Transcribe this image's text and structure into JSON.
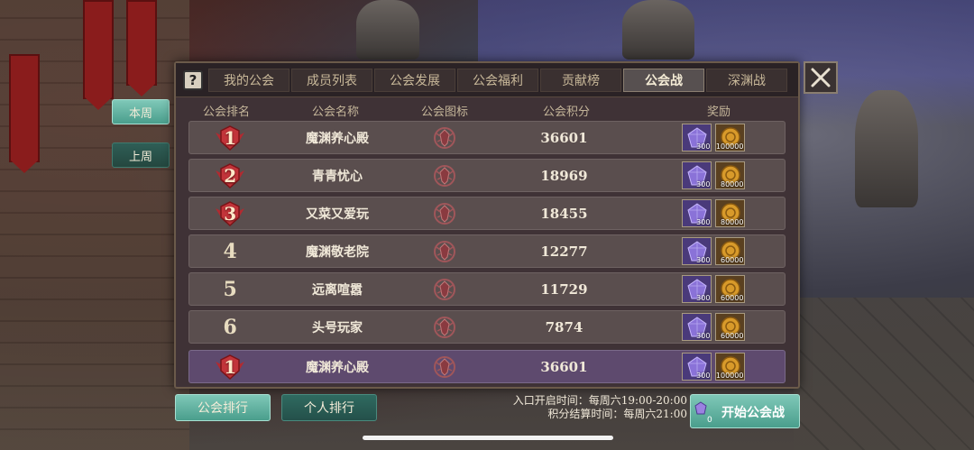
{
  "side_tabs": {
    "this_week": "本周",
    "last_week": "上周"
  },
  "tabs": [
    {
      "label": "我的公会",
      "active": false
    },
    {
      "label": "成员列表",
      "active": false
    },
    {
      "label": "公会发展",
      "active": false
    },
    {
      "label": "公会福利",
      "active": false
    },
    {
      "label": "贡献榜",
      "active": false
    },
    {
      "label": "公会战",
      "active": true
    },
    {
      "label": "深渊战",
      "active": false
    }
  ],
  "help_label": "?",
  "table": {
    "headers": [
      "公会排名",
      "公会名称",
      "公会图标",
      "公会积分",
      "奖励"
    ],
    "rows": [
      {
        "rank": "1",
        "name": "魔渊养心殿",
        "score": "36601",
        "gem": "300",
        "coin": "100000"
      },
      {
        "rank": "2",
        "name": "青青忧心",
        "score": "18969",
        "gem": "300",
        "coin": "80000"
      },
      {
        "rank": "3",
        "name": "又菜又爱玩",
        "score": "18455",
        "gem": "300",
        "coin": "80000"
      },
      {
        "rank": "4",
        "name": "魔渊敬老院",
        "score": "12277",
        "gem": "300",
        "coin": "60000"
      },
      {
        "rank": "5",
        "name": "远离喧嚣",
        "score": "11729",
        "gem": "300",
        "coin": "60000"
      },
      {
        "rank": "6",
        "name": "头号玩家",
        "score": "7874",
        "gem": "300",
        "coin": "60000"
      }
    ],
    "self_row": {
      "rank": "1",
      "name": "魔渊养心殿",
      "score": "36601",
      "gem": "300",
      "coin": "100000"
    }
  },
  "bottom": {
    "guild_rank_button": "公会排行",
    "personal_rank_button": "个人排行",
    "entry_time": "入口开启时间：每周六19:00-20:00",
    "settle_time": "积分结算时间：每周六21:00",
    "start_button": "开始公会战",
    "start_cost": "0"
  },
  "colors": {
    "accent_teal": "#5fb2a2",
    "panel_bg": "#3f3236",
    "self_row_bg": "#5e4a6e",
    "rank_badge_red": "#c2343a",
    "gem_purple": "#8a72d8",
    "coin_gold": "#d89a2a"
  },
  "icons": {
    "help": "question-mark-icon",
    "close": "close-x-icon",
    "emblem": "guild-emblem-icon",
    "gem": "purple-gem-icon",
    "coin": "gold-coin-icon",
    "rank_badge": "winged-badge-icon"
  }
}
